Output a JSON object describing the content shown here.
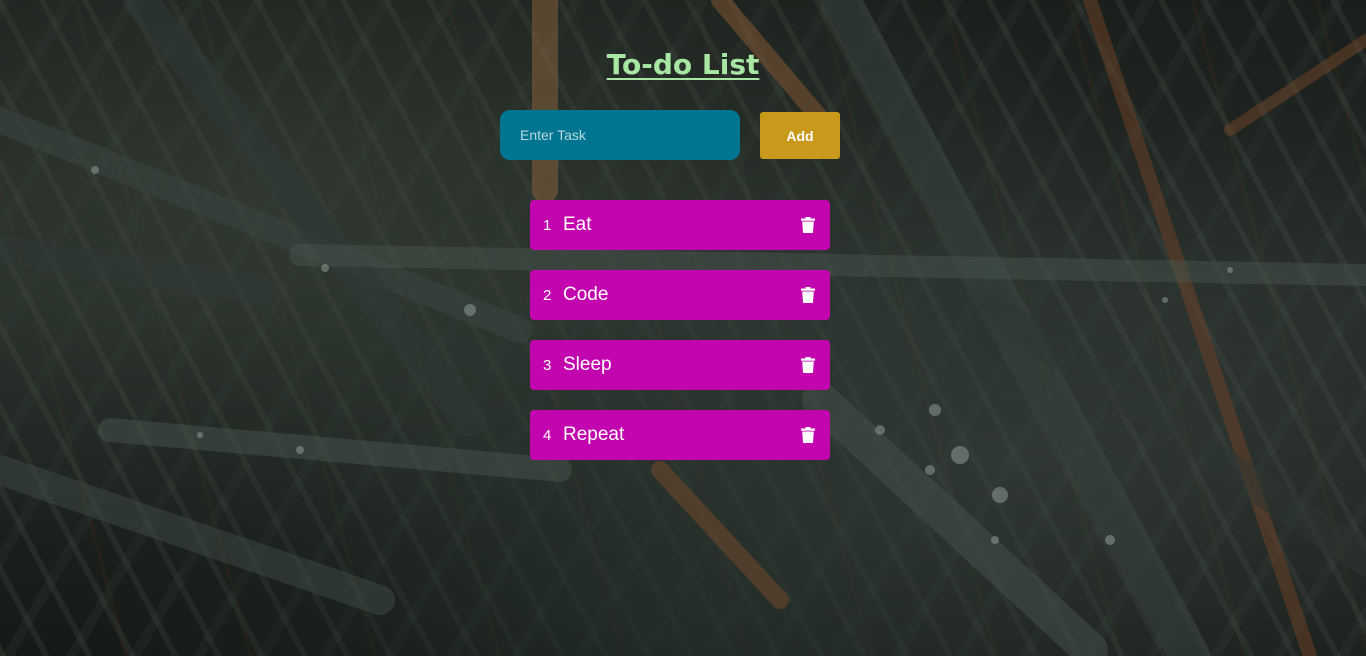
{
  "header": {
    "title": "To-do List"
  },
  "form": {
    "input_placeholder": "Enter Task",
    "input_value": "",
    "add_label": "Add"
  },
  "tasks": [
    {
      "number": "1",
      "text": "Eat",
      "delete_icon": "trash-icon"
    },
    {
      "number": "2",
      "text": "Code",
      "delete_icon": "trash-icon"
    },
    {
      "number": "3",
      "text": "Sleep",
      "delete_icon": "trash-icon"
    },
    {
      "number": "4",
      "text": "Repeat",
      "delete_icon": "trash-icon"
    }
  ],
  "colors": {
    "title": "#a8e6a3",
    "input_bg": "#007591",
    "add_button_bg": "#c8991a",
    "task_bg": "#c305b0",
    "text": "#ffffff"
  }
}
